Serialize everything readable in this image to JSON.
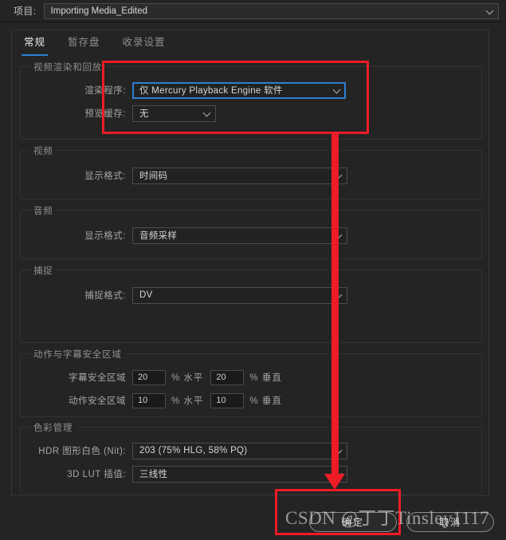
{
  "window": {
    "background_color": "#242424",
    "accent_color": "#2d7fd3",
    "annotation_color": "#ee1c26"
  },
  "project_bar": {
    "label": "项目:",
    "value": "Importing Media_Edited",
    "chevron": "chevron-down-icon"
  },
  "tabs": [
    {
      "label": "常规",
      "active": true
    },
    {
      "label": "暂存盘",
      "active": false
    },
    {
      "label": "收录设置",
      "active": false
    }
  ],
  "groups": {
    "video_render": {
      "legend": "视频渲染和回放",
      "renderer": {
        "label": "渲染程序:",
        "value": "仅 Mercury Playback Engine 软件"
      },
      "preview_cache": {
        "label": "预览缓存:",
        "value": "无"
      }
    },
    "video": {
      "legend": "视频",
      "display_format": {
        "label": "显示格式:",
        "value": "时间码"
      }
    },
    "audio": {
      "legend": "音频",
      "display_format": {
        "label": "显示格式:",
        "value": "音频采样"
      }
    },
    "capture": {
      "legend": "捕捉",
      "capture_format": {
        "label": "捕捉格式:",
        "value": "DV"
      }
    },
    "safe_areas": {
      "legend": "动作与字幕安全区域",
      "title_safe": {
        "label": "字幕安全区域",
        "horizontal": "20",
        "horizontal_unit": "% 水平",
        "vertical": "20",
        "vertical_unit": "% 垂直"
      },
      "action_safe": {
        "label": "动作安全区域",
        "horizontal": "10",
        "horizontal_unit": "% 水平",
        "vertical": "10",
        "vertical_unit": "% 垂直"
      }
    },
    "color_management": {
      "legend": "色彩管理",
      "hdr_white": {
        "label": "HDR 图形白色 (Nit):",
        "value": "203 (75% HLG, 58% PQ)"
      },
      "lut_interp": {
        "label": "3D LUT 插值:",
        "value": "三线性"
      }
    }
  },
  "buttons": {
    "ok": "确定",
    "cancel": "取消"
  },
  "watermark": {
    "text": "CSDN @丁丁Tinsley1117"
  }
}
